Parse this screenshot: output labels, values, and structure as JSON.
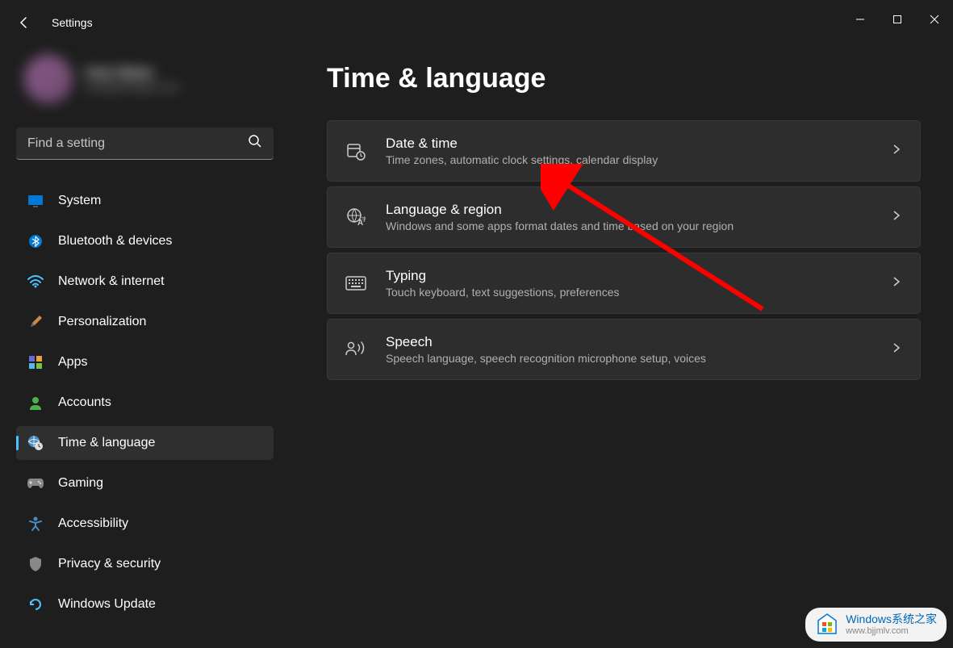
{
  "app": {
    "title": "Settings"
  },
  "search": {
    "placeholder": "Find a setting"
  },
  "profile": {
    "name": "User Name",
    "email": "user@example.com"
  },
  "sidebar": {
    "items": [
      {
        "label": "System",
        "icon": "system"
      },
      {
        "label": "Bluetooth & devices",
        "icon": "bluetooth"
      },
      {
        "label": "Network & internet",
        "icon": "wifi"
      },
      {
        "label": "Personalization",
        "icon": "brush"
      },
      {
        "label": "Apps",
        "icon": "apps"
      },
      {
        "label": "Accounts",
        "icon": "accounts"
      },
      {
        "label": "Time & language",
        "icon": "time-language",
        "active": true
      },
      {
        "label": "Gaming",
        "icon": "gaming"
      },
      {
        "label": "Accessibility",
        "icon": "accessibility"
      },
      {
        "label": "Privacy & security",
        "icon": "privacy"
      },
      {
        "label": "Windows Update",
        "icon": "update"
      }
    ]
  },
  "page": {
    "title": "Time & language"
  },
  "settings": [
    {
      "title": "Date & time",
      "desc": "Time zones, automatic clock settings, calendar display",
      "icon": "date-time"
    },
    {
      "title": "Language & region",
      "desc": "Windows and some apps format dates and time based on your region",
      "icon": "language-region"
    },
    {
      "title": "Typing",
      "desc": "Touch keyboard, text suggestions, preferences",
      "icon": "typing"
    },
    {
      "title": "Speech",
      "desc": "Speech language, speech recognition microphone setup, voices",
      "icon": "speech"
    }
  ],
  "watermark": {
    "line1": "Windows系统之家",
    "line2": "www.bjjmlv.com"
  }
}
